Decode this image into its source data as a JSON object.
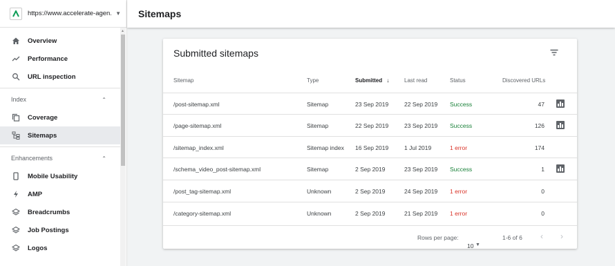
{
  "property": {
    "url": "https://www.accelerate-agen..."
  },
  "nav": {
    "overview": "Overview",
    "performance": "Performance",
    "url_inspection": "URL inspection",
    "group_index": "Index",
    "coverage": "Coverage",
    "sitemaps": "Sitemaps",
    "group_enhancements": "Enhancements",
    "mobile_usability": "Mobile Usability",
    "amp": "AMP",
    "breadcrumbs": "Breadcrumbs",
    "job_postings": "Job Postings",
    "logos": "Logos"
  },
  "header": {
    "title": "Sitemaps"
  },
  "card": {
    "title": "Submitted sitemaps"
  },
  "table": {
    "headers": {
      "sitemap": "Sitemap",
      "type": "Type",
      "submitted": "Submitted",
      "last_read": "Last read",
      "status": "Status",
      "discovered": "Discovered URLs"
    },
    "rows": [
      {
        "sitemap": "/post-sitemap.xml",
        "type": "Sitemap",
        "submitted": "23 Sep 2019",
        "last_read": "22 Sep 2019",
        "status": "Success",
        "discovered": "47"
      },
      {
        "sitemap": "/page-sitemap.xml",
        "type": "Sitemap",
        "submitted": "22 Sep 2019",
        "last_read": "23 Sep 2019",
        "status": "Success",
        "discovered": "126"
      },
      {
        "sitemap": "/sitemap_index.xml",
        "type": "Sitemap index",
        "submitted": "16 Sep 2019",
        "last_read": "1 Jul 2019",
        "status": "1 error",
        "discovered": "174"
      },
      {
        "sitemap": "/schema_video_post-sitemap.xml",
        "type": "Sitemap",
        "submitted": "2 Sep 2019",
        "last_read": "23 Sep 2019",
        "status": "Success",
        "discovered": "1"
      },
      {
        "sitemap": "/post_tag-sitemap.xml",
        "type": "Unknown",
        "submitted": "2 Sep 2019",
        "last_read": "24 Sep 2019",
        "status": "1 error",
        "discovered": "0"
      },
      {
        "sitemap": "/category-sitemap.xml",
        "type": "Unknown",
        "submitted": "2 Sep 2019",
        "last_read": "21 Sep 2019",
        "status": "1 error",
        "discovered": "0"
      }
    ]
  },
  "pagination": {
    "rows_per_page_label": "Rows per page:",
    "rows_per_page": "10",
    "range": "1-6 of 6"
  },
  "colors": {
    "success": "#188038",
    "error": "#d93025",
    "logo": "#0f9d58"
  }
}
